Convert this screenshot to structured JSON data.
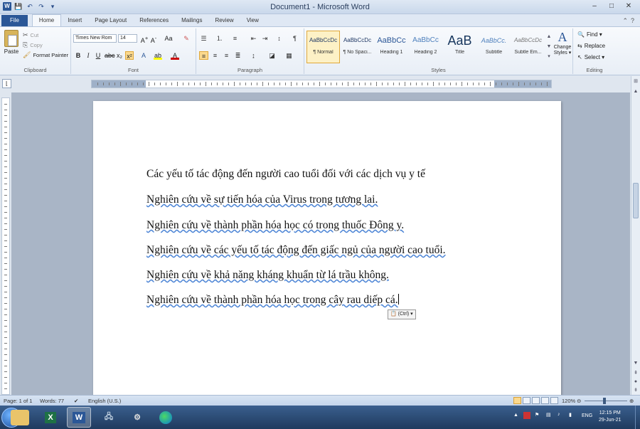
{
  "window": {
    "title": "Document1 - Microsoft Word"
  },
  "quick_access": {
    "save": "💾",
    "undo": "↶",
    "redo": "↷",
    "customize": "▾"
  },
  "window_controls": {
    "minimize": "–",
    "maximize": "□",
    "close": "✕"
  },
  "tabs": [
    {
      "label": "File"
    },
    {
      "label": "Home"
    },
    {
      "label": "Insert"
    },
    {
      "label": "Page Layout"
    },
    {
      "label": "References"
    },
    {
      "label": "Mailings"
    },
    {
      "label": "Review"
    },
    {
      "label": "View"
    }
  ],
  "clipboard": {
    "paste": "Paste",
    "cut": "Cut",
    "copy": "Copy",
    "format_painter": "Format Painter",
    "group": "Clipboard"
  },
  "font": {
    "name": "Times New Rom",
    "size": "14",
    "group": "Font"
  },
  "paragraph": {
    "group": "Paragraph"
  },
  "styles": {
    "group": "Styles",
    "items": [
      {
        "preview": "AaBbCcDc",
        "label": "¶ Normal"
      },
      {
        "preview": "AaBbCcDc",
        "label": "¶ No Spaci..."
      },
      {
        "preview": "AaBbCc",
        "label": "Heading 1"
      },
      {
        "preview": "AaBbCc",
        "label": "Heading 2"
      },
      {
        "preview": "AaB",
        "label": "Title"
      },
      {
        "preview": "AaBbCc.",
        "label": "Subtitle"
      },
      {
        "preview": "AaBbCcDc",
        "label": "Subtle Em..."
      }
    ],
    "change_styles": "Change Styles ▾"
  },
  "editing": {
    "find": "Find ▾",
    "replace": "Replace",
    "select": "Select ▾",
    "group": "Editing"
  },
  "document": {
    "lines": [
      "Các yếu tố tác động đến người cao tuổi đối với các dịch vụ y tế",
      "Nghiên cứu về sự tiến hóa của Virus trong tương lai.",
      "Nghiên cứu về thành phần hóa học có trong thuốc Đông y.",
      "Nghiên cứu về các yếu tố tác động đến giấc ngủ của người cao tuổi.",
      "Nghiên cứu về khả năng kháng khuẩn từ lá trầu không.",
      "Nghiên cứu về thành phần hóa học trong cây rau diếp cá."
    ],
    "paste_options": "(Ctrl) ▾"
  },
  "status": {
    "page": "Page: 1 of 1",
    "words": "Words: 77",
    "language": "English (U.S.)",
    "zoom": "120%"
  },
  "tray": {
    "lang": "ENG",
    "time": "12:15 PM",
    "date": "29-Jun-21"
  }
}
